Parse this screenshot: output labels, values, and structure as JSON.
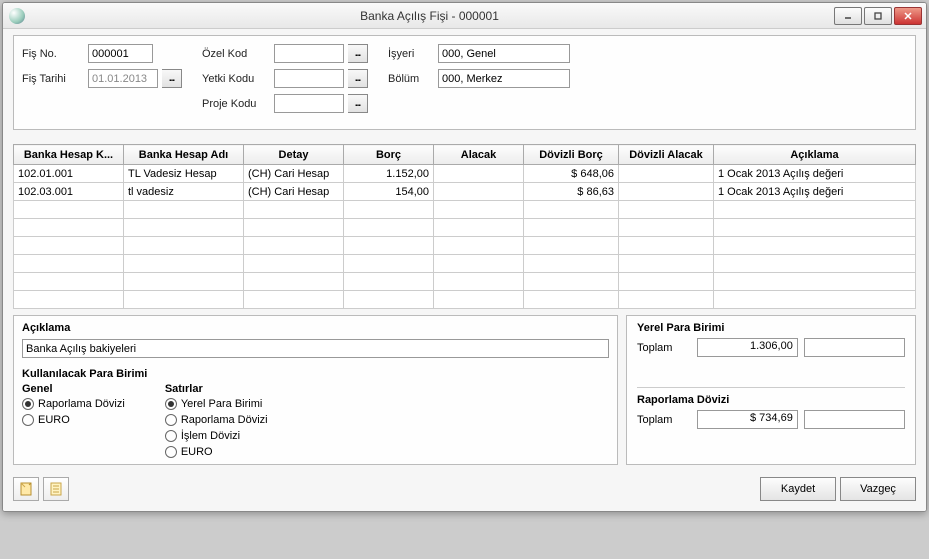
{
  "window": {
    "title": "Banka Açılış Fişi - 000001"
  },
  "header": {
    "fis_no_label": "Fiş No.",
    "fis_no": "000001",
    "fis_tarihi_label": "Fiş Tarihi",
    "fis_tarihi": "01.01.2013",
    "ozel_kod_label": "Özel Kod",
    "ozel_kod": "",
    "yetki_kodu_label": "Yetki Kodu",
    "yetki_kodu": "",
    "proje_kodu_label": "Proje Kodu",
    "proje_kodu": "",
    "isyeri_label": "İşyeri",
    "isyeri": "000, Genel",
    "bolum_label": "Bölüm",
    "bolum": "000, Merkez"
  },
  "grid": {
    "columns": [
      "Banka Hesap K...",
      "Banka Hesap Adı",
      "Detay",
      "Borç",
      "Alacak",
      "Dövizli Borç",
      "Dövizli Alacak",
      "Açıklama"
    ],
    "rows": [
      {
        "kod": "102.01.001",
        "ad": "TL Vadesiz Hesap",
        "detay": "(CH) Cari Hesap",
        "borc": "1.152,00",
        "alacak": "",
        "dborc": "$ 648,06",
        "dalacak": "",
        "aciklama": "1 Ocak 2013 Açılış değeri"
      },
      {
        "kod": "102.03.001",
        "ad": "tl vadesiz",
        "detay": "(CH) Cari Hesap",
        "borc": "154,00",
        "alacak": "",
        "dborc": "$ 86,63",
        "dalacak": "",
        "aciklama": "1 Ocak 2013 Açılış değeri"
      }
    ]
  },
  "description": {
    "label": "Açıklama",
    "value": "Banka Açılış bakiyeleri"
  },
  "currency": {
    "group_label": "Kullanılacak Para Birimi",
    "genel_label": "Genel",
    "satirlar_label": "Satırlar",
    "genel_options": [
      "Raporlama Dövizi",
      "EURO"
    ],
    "satir_options": [
      "Yerel Para Birimi",
      "Raporlama Dövizi",
      "İşlem Dövizi",
      "EURO"
    ],
    "genel_selected": "Raporlama Dövizi",
    "satir_selected": "Yerel Para Birimi"
  },
  "totals": {
    "yerel_label": "Yerel Para Birimi",
    "rapor_label": "Raporlama Dövizi",
    "toplam_label": "Toplam",
    "yerel_total": "1.306,00",
    "rapor_total": "$ 734,69"
  },
  "footer": {
    "save": "Kaydet",
    "cancel": "Vazgeç"
  }
}
